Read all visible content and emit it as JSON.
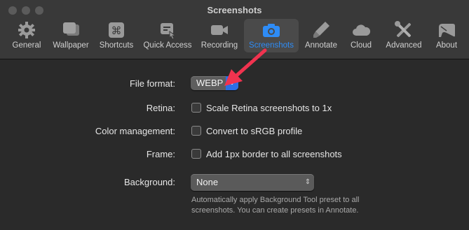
{
  "window": {
    "title": "Screenshots"
  },
  "toolbar": {
    "items": [
      {
        "label": "General",
        "icon": "gear-icon"
      },
      {
        "label": "Wallpaper",
        "icon": "wallpaper-icon"
      },
      {
        "label": "Shortcuts",
        "icon": "command-key-icon"
      },
      {
        "label": "Quick Access",
        "icon": "quick-access-icon"
      },
      {
        "label": "Recording",
        "icon": "video-camera-icon"
      },
      {
        "label": "Screenshots",
        "icon": "camera-icon"
      },
      {
        "label": "Annotate",
        "icon": "marker-icon"
      },
      {
        "label": "Cloud",
        "icon": "cloud-icon"
      },
      {
        "label": "Advanced",
        "icon": "tools-icon"
      },
      {
        "label": "About",
        "icon": "about-icon"
      }
    ],
    "active": "Screenshots",
    "accent_color": "#2e8cf6"
  },
  "settings": {
    "file_format": {
      "label": "File format:",
      "value": "WEBP"
    },
    "retina": {
      "label": "Retina:",
      "option": "Scale Retina screenshots to 1x",
      "checked": false
    },
    "color_management": {
      "label": "Color management:",
      "option": "Convert to sRGB profile",
      "checked": false
    },
    "frame": {
      "label": "Frame:",
      "option": "Add 1px border to all screenshots",
      "checked": false
    },
    "background": {
      "label": "Background:",
      "value": "None",
      "help": "Automatically apply Background Tool preset to all screenshots. You can create presets in Annotate."
    }
  },
  "annotation": {
    "arrow_color": "#f0334f"
  }
}
